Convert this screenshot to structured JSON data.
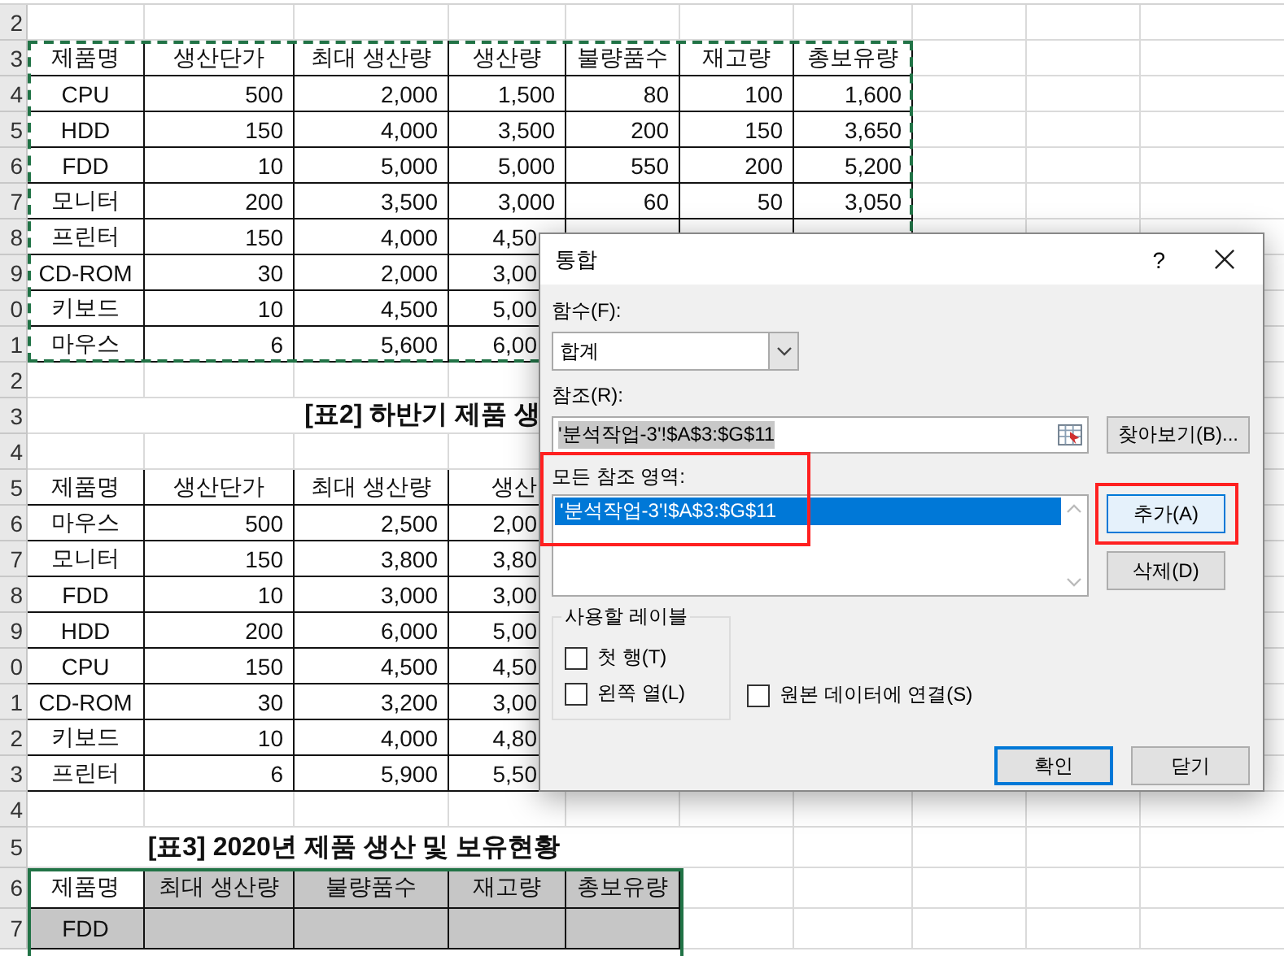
{
  "row_numbers": [
    "2",
    "3",
    "4",
    "5",
    "6",
    "7",
    "8",
    "9",
    "0",
    "1",
    "2",
    "3",
    "4",
    "5",
    "6",
    "7",
    "8",
    "9",
    "0",
    "1",
    "2",
    "3",
    "4",
    "5",
    "6",
    "7"
  ],
  "table1": {
    "columns": [
      "제품명",
      "생산단가",
      "최대 생산량",
      "생산량",
      "불량품수",
      "재고량",
      "총보유량"
    ],
    "rows": [
      {
        "cells": [
          "CPU",
          "500",
          "2,000",
          "1,500",
          "80",
          "100",
          "1,600"
        ]
      },
      {
        "cells": [
          "HDD",
          "150",
          "4,000",
          "3,500",
          "200",
          "150",
          "3,650"
        ]
      },
      {
        "cells": [
          "FDD",
          "10",
          "5,000",
          "5,000",
          "550",
          "200",
          "5,200"
        ]
      },
      {
        "cells": [
          "모니터",
          "200",
          "3,500",
          "3,000",
          "60",
          "50",
          "3,050"
        ]
      },
      {
        "cells": [
          "프린터",
          "150",
          "4,000",
          "4,50"
        ]
      },
      {
        "cells": [
          "CD-ROM",
          "30",
          "2,000",
          "3,00"
        ]
      },
      {
        "cells": [
          "키보드",
          "10",
          "4,500",
          "5,00"
        ]
      },
      {
        "cells": [
          "마우스",
          "6",
          "5,600",
          "6,00"
        ]
      }
    ]
  },
  "table2": {
    "title": "[표2] 하반기 제품 생",
    "columns": [
      "제품명",
      "생산단가",
      "최대 생산량",
      "생산"
    ],
    "rows": [
      {
        "cells": [
          "마우스",
          "500",
          "2,500",
          "2,00"
        ]
      },
      {
        "cells": [
          "모니터",
          "150",
          "3,800",
          "3,80"
        ]
      },
      {
        "cells": [
          "FDD",
          "10",
          "3,000",
          "3,00"
        ]
      },
      {
        "cells": [
          "HDD",
          "200",
          "6,000",
          "5,00"
        ]
      },
      {
        "cells": [
          "CPU",
          "150",
          "4,500",
          "4,50"
        ]
      },
      {
        "cells": [
          "CD-ROM",
          "30",
          "3,200",
          "3,00"
        ]
      },
      {
        "cells": [
          "키보드",
          "10",
          "4,000",
          "4,80"
        ]
      },
      {
        "cells": [
          "프린터",
          "6",
          "5,900",
          "5,50"
        ]
      }
    ]
  },
  "table3": {
    "title": "[표3] 2020년 제품 생산 및 보유현황",
    "columns": [
      {
        "text": "제품명",
        "active": true
      },
      {
        "text": "최대 생산량",
        "active": false
      },
      {
        "text": "불량품수",
        "active": false
      },
      {
        "text": "재고량",
        "active": false
      },
      {
        "text": "총보유량",
        "active": false
      }
    ],
    "rows": [
      {
        "cells": [
          {
            "text": "FDD",
            "active": false
          }
        ]
      }
    ]
  },
  "dialog": {
    "title": "통합",
    "help": "?",
    "function": {
      "label": "함수(F):",
      "value": "합계"
    },
    "reference": {
      "label": "참조(R):",
      "value": "'분석작업-3'!$A$3:$G$11",
      "browse": "찾아보기(B)..."
    },
    "all_references": {
      "label": "모든 참조 영역:",
      "highlighted": true,
      "items": [
        {
          "text": "'분석작업-3'!$A$3:$G$11",
          "selected": true
        }
      ]
    },
    "side_buttons": [
      {
        "label": "추가(A)",
        "focused": true,
        "highlighted": true
      },
      {
        "label": "삭제(D)",
        "focused": false,
        "highlighted": false
      }
    ],
    "labels_group": {
      "title": "사용할 레이블",
      "options": [
        {
          "label": "첫 행(T)",
          "checked": false
        },
        {
          "label": "왼쪽 열(L)",
          "checked": false
        }
      ]
    },
    "link_option": {
      "label": "원본 데이터에 연결(S)",
      "checked": false
    },
    "footer_buttons": [
      {
        "label": "확인",
        "default": true
      },
      {
        "label": "닫기",
        "default": false
      }
    ]
  }
}
